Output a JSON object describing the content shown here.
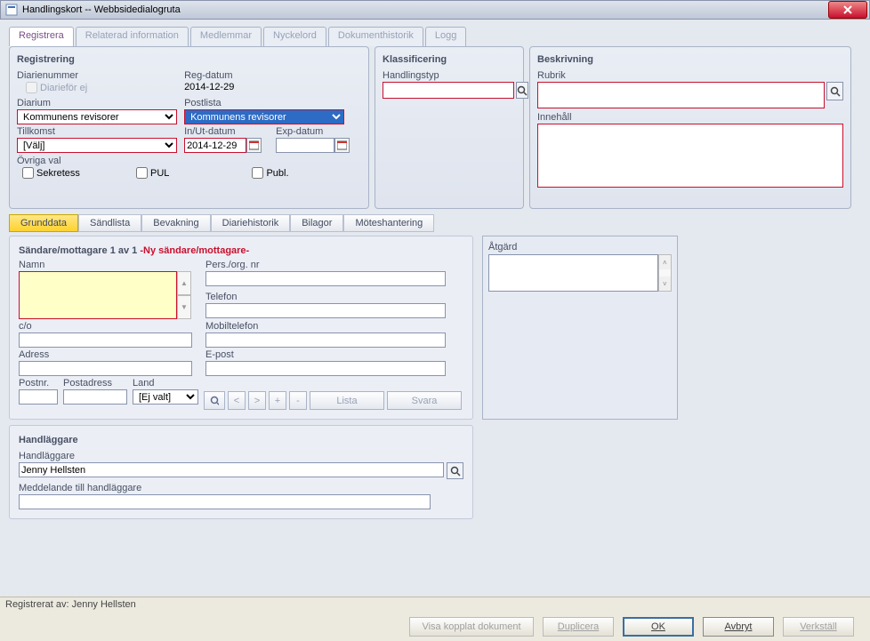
{
  "window": {
    "title": "Handlingskort -- Webbsidedialogruta"
  },
  "top_tabs": {
    "registrera": "Registrera",
    "relaterad": "Relaterad information",
    "medlemmar": "Medlemmar",
    "nyckelord": "Nyckelord",
    "dokhist": "Dokumenthistorik",
    "logg": "Logg"
  },
  "registrering": {
    "title": "Registrering",
    "diarienummer_label": "Diarienummer",
    "diariefor_ej": "Diarieför ej",
    "reg_datum_label": "Reg-datum",
    "reg_datum": "2014-12-29",
    "diarium_label": "Diarium",
    "diarium_value": "Kommunens revisorer",
    "postlista_label": "Postlista",
    "postlista_value": "Kommunens revisorer",
    "tillkomst_label": "Tillkomst",
    "tillkomst_value": "[Välj]",
    "inut_label": "In/Ut-datum",
    "inut_value": "2014-12-29",
    "exp_label": "Exp-datum",
    "exp_value": "",
    "ovriga_label": "Övriga val",
    "sekretess": "Sekretess",
    "pul": "PUL",
    "publ": "Publ."
  },
  "klassificering": {
    "title": "Klassificering",
    "handlingstyp_label": "Handlingstyp",
    "handlingstyp_value": ""
  },
  "beskrivning": {
    "title": "Beskrivning",
    "rubrik_label": "Rubrik",
    "rubrik_value": "",
    "innehall_label": "Innehåll",
    "innehall_value": ""
  },
  "sub_tabs": {
    "grunddata": "Grunddata",
    "sandlista": "Sändlista",
    "bevakning": "Bevakning",
    "diariehist": "Diariehistorik",
    "bilagor": "Bilagor",
    "moteshant": "Möteshantering"
  },
  "sender": {
    "title_prefix": "Sändare/mottagare 1 av 1 ",
    "title_red": "-Ny sändare/mottagare-",
    "namn_label": "Namn",
    "namn_value": "",
    "persorg_label": "Pers./org. nr",
    "persorg_value": "",
    "telefon_label": "Telefon",
    "telefon_value": "",
    "co_label": "c/o",
    "co_value": "",
    "mobil_label": "Mobiltelefon",
    "mobil_value": "",
    "adress_label": "Adress",
    "adress_value": "",
    "epost_label": "E-post",
    "epost_value": "",
    "postnr_label": "Postnr.",
    "postnr_value": "",
    "postadress_label": "Postadress",
    "postadress_value": "",
    "land_label": "Land",
    "land_value": "[Ej valt]",
    "lista_btn": "Lista",
    "svara_btn": "Svara"
  },
  "atgard": {
    "label": "Åtgärd",
    "value": ""
  },
  "handlaggare": {
    "title": "Handläggare",
    "hl_label": "Handläggare",
    "hl_value": "Jenny Hellsten",
    "medd_label": "Meddelande till handläggare",
    "medd_value": ""
  },
  "status": {
    "text": "Registrerat av: Jenny Hellsten"
  },
  "buttons": {
    "visa": "Visa kopplat dokument",
    "duplicera": "Duplicera",
    "ok": "OK",
    "avbryt": "Avbryt",
    "verkstall": "Verkställ"
  }
}
